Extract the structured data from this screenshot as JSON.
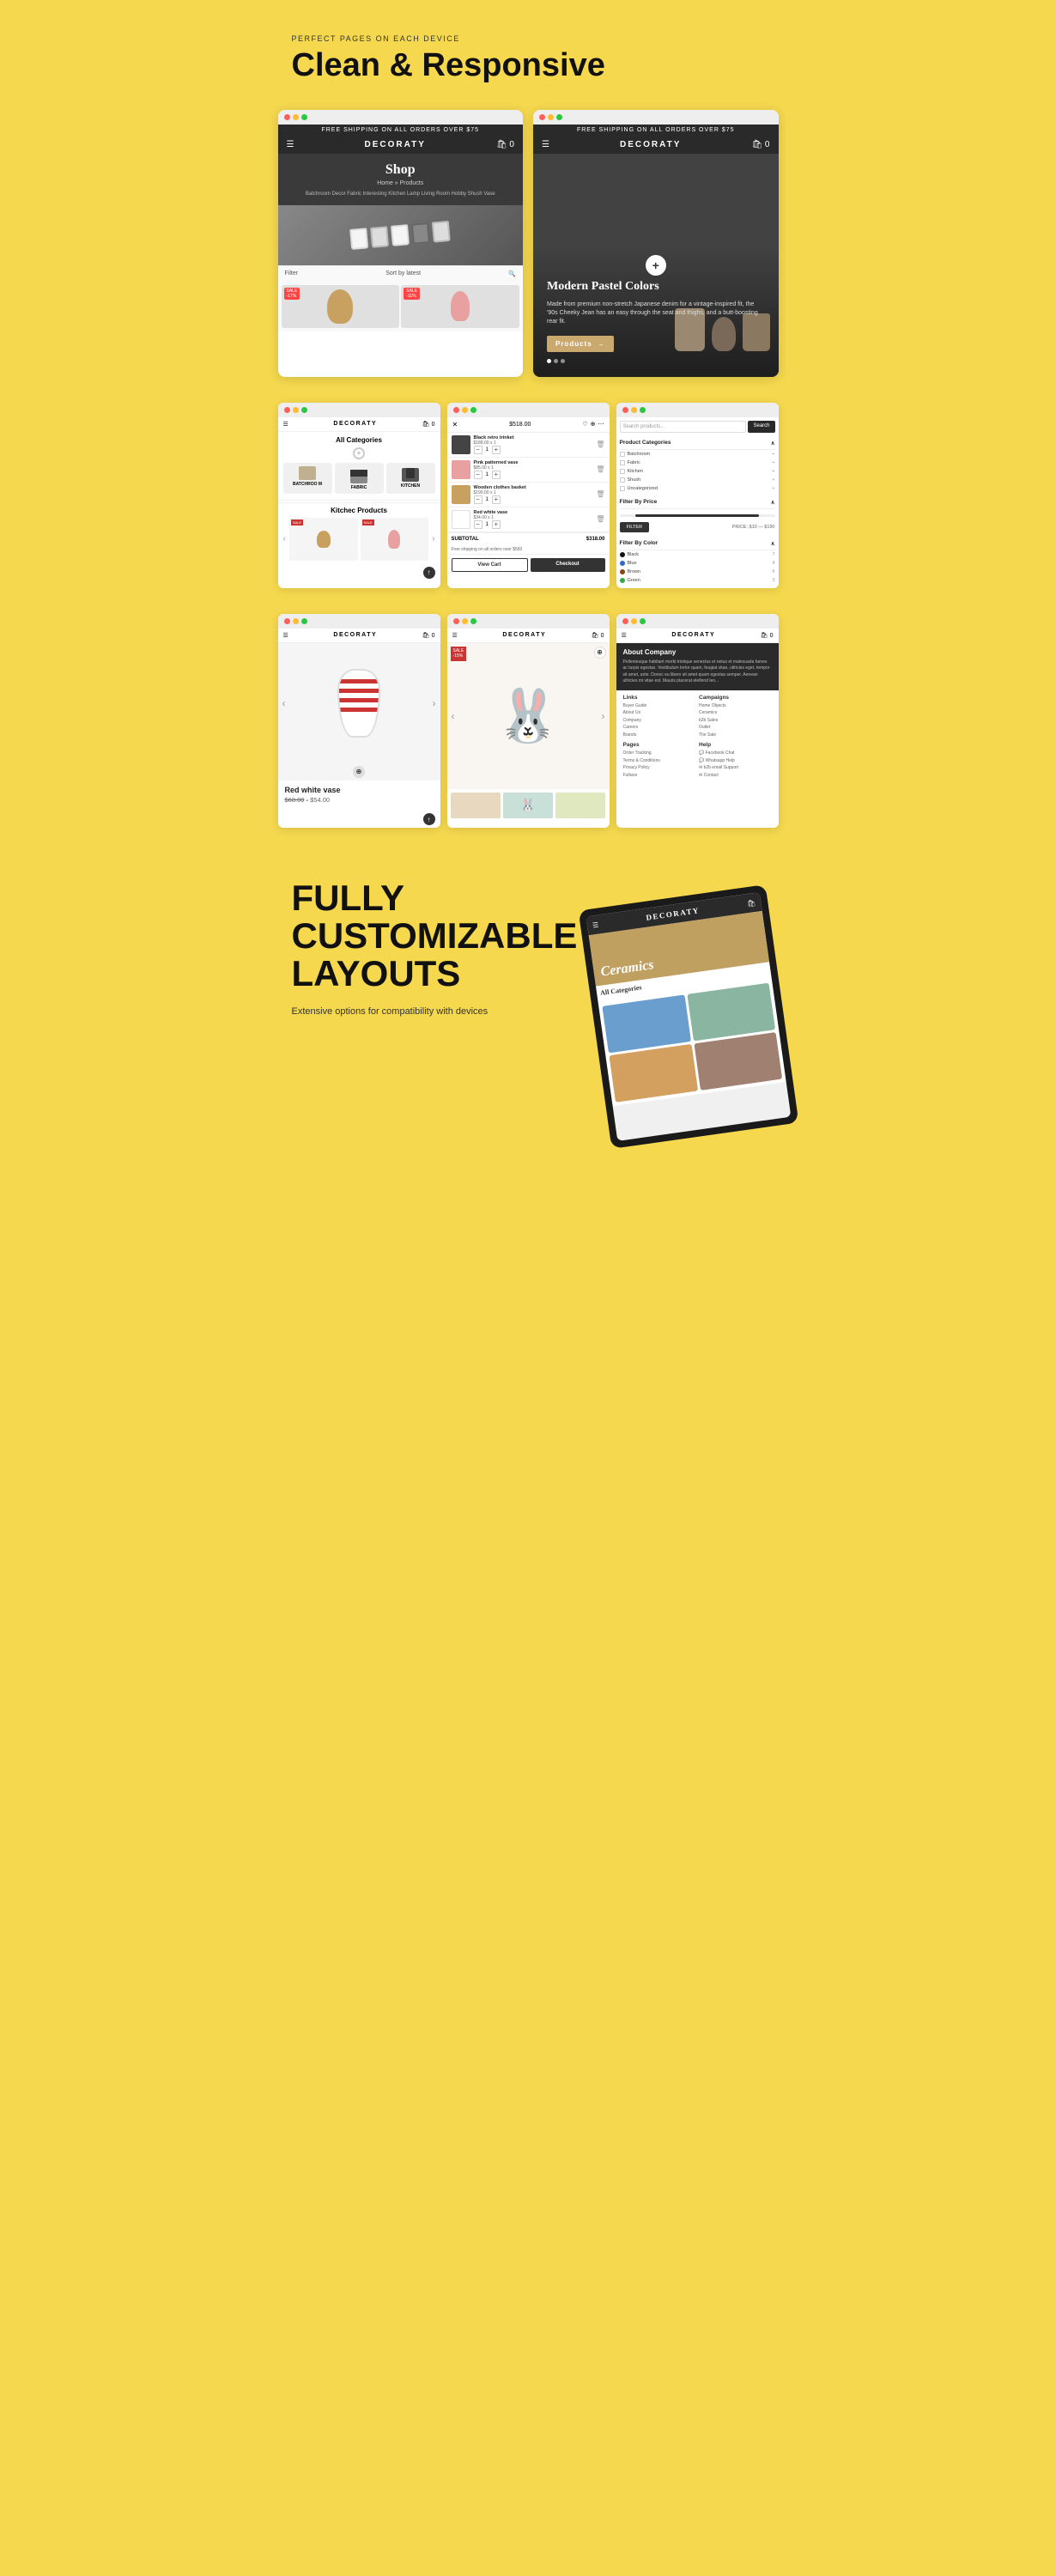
{
  "page": {
    "background_color": "#f5d84e"
  },
  "section1": {
    "eyebrow": "PERFECT PAGES ON EACH DEVICE",
    "title": "Clean & Responsive"
  },
  "mockup_left": {
    "store_name": "DECORATY",
    "free_shipping": "FREE SHIPPING ON ALL ORDERS OVER $75",
    "shop_title": "Shop",
    "breadcrumb": "Home » Products",
    "categories": "Batchroom   Decor   Fabric   Interesting   Kitchen   Lamp   Living Room   Hobby   Shush   Vase",
    "filter_label": "Filter",
    "sort_label": "Sort by latest"
  },
  "mockup_right": {
    "store_name": "DECORATY",
    "free_shipping": "FREE SHIPPING ON ALL ORDERS OVER $75",
    "hero_title": "Modern Pastel Colors",
    "hero_description": "Made from premium non-stretch Japanese denim for a vintage-inspired fit, the '90s Cheeky Jean has an easy through the seat and thighs, and a butt-boosting rear fit.",
    "products_btn": "Products",
    "dots": 3
  },
  "row2": {
    "mockup_categories": {
      "store_name": "DECORATY",
      "title": "All Categories",
      "cats": [
        "BATCHROO M",
        "FABRIC",
        "KITCHEN"
      ],
      "kitchec_title": "Kitchec Products"
    },
    "mockup_cart": {
      "items": [
        {
          "name": "Black retro trinket",
          "price": "$188.00 x 1",
          "total": ""
        },
        {
          "name": "Pink patterned vase",
          "price": "$85.00 x 1",
          "total": ""
        },
        {
          "name": "Wooden clothes basket",
          "price": "$190.00 x 1",
          "total": ""
        },
        {
          "name": "Red white vase",
          "price": "$34.00 x 1",
          "total": ""
        }
      ],
      "subtotal_label": "SUBTOTAL",
      "subtotal_value": "$318.00",
      "free_shipping_note": "Free shipping on all orders over $550",
      "view_cart_btn": "View Cart",
      "checkout_btn": "Checkout"
    },
    "mockup_search": {
      "placeholder": "Search products...",
      "search_btn": "Search",
      "product_cats_label": "Product Categories",
      "categories": [
        "Batchroom",
        "Fabric",
        "Kitchen",
        "Shush",
        "Uncategorized"
      ],
      "filter_price_label": "Filter By Price",
      "price_range": "PRICE: $10 — $190",
      "filter_btn": "FILTER",
      "filter_color_label": "Filter By Color",
      "colors": [
        {
          "name": "Black",
          "hex": "#111",
          "count": 7
        },
        {
          "name": "Blue",
          "hex": "#3366cc",
          "count": 4
        },
        {
          "name": "Brown",
          "hex": "#8B4513",
          "count": 6
        },
        {
          "name": "Green",
          "hex": "#33aa44",
          "count": 3
        }
      ]
    }
  },
  "row3": {
    "mockup_vase": {
      "store_name": "DECORATY",
      "product_name": "Red white vase",
      "price_old": "$68.00",
      "price_new": "$54.00"
    },
    "mockup_rabbit": {
      "store_name": "DECORATY",
      "sale_badge": "SALE"
    },
    "mockup_about": {
      "store_name": "DECORATY",
      "about_title": "About Company",
      "about_text": "Pellentesque habitant morbi tristique senectus et netus et malesuada fames ac turpis egestas. Vestibulum tortor quam, feugiat vitae, ultricies eget, tempor sit amet, ante. Donec eu libero sit amet quam egestas semper. Aenean ultricies mi vitae est. Mauris placerat eleifend leo...",
      "columns": {
        "links_title": "Links",
        "links": [
          "Buyer Guide",
          "About Us",
          "Company",
          "Careers",
          "Brands"
        ],
        "campaigns_title": "Campaigns",
        "campaigns": [
          "Home Objects",
          "Ceramics",
          "b2b Sales",
          "Outlet",
          "The Sale"
        ],
        "pages_title": "Pages",
        "pages": [
          "Order Tracking",
          "Terms & Conditions",
          "Privacy Policy",
          "Fullsize"
        ],
        "help_title": "Help",
        "help": [
          "Facebook Chat",
          "Whatsapp Help",
          "b2b email Support",
          "Contact"
        ]
      }
    }
  },
  "section2": {
    "title_line1": "FULLY",
    "title_line2": "CUSTOMIZABLE",
    "title_line3": "LAYOUTS",
    "description": "Extensive options for\ncompatibility with devices",
    "tablet_title": "Ceramics"
  }
}
